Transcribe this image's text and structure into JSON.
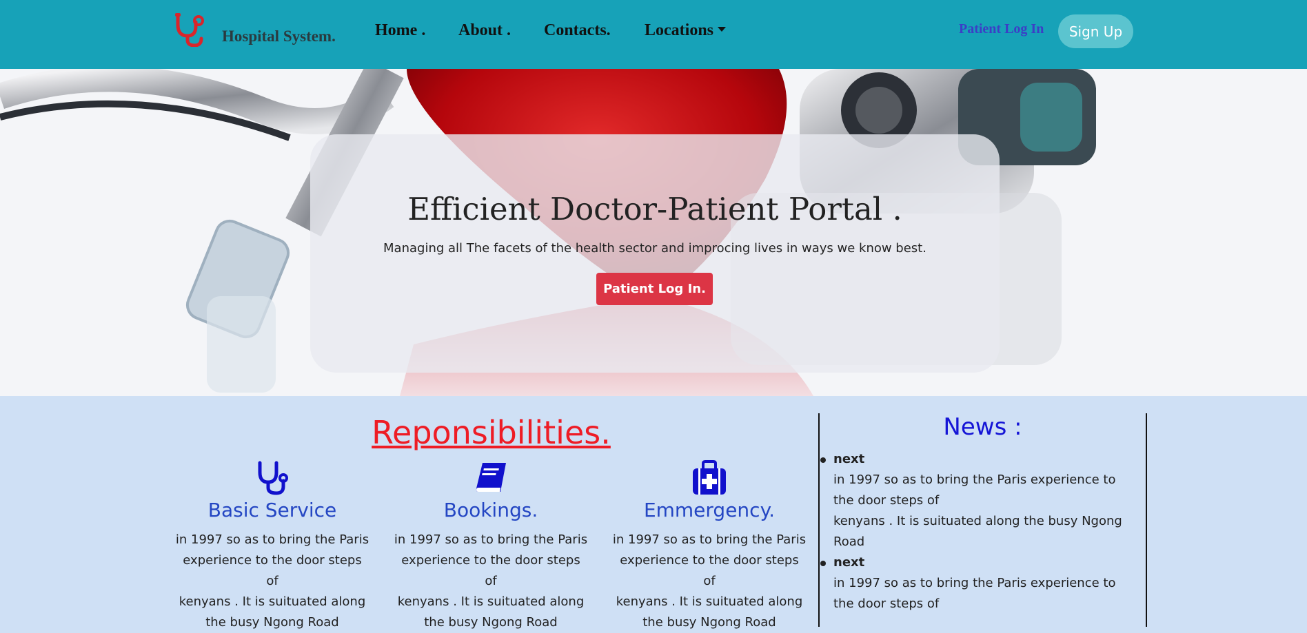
{
  "nav": {
    "brand": "Hospital System.",
    "links": [
      "Home .",
      "About .",
      "Contacts.",
      "Locations"
    ],
    "patient_login": "Patient Log In",
    "signup": "Sign Up"
  },
  "hero": {
    "title": "Efficient Doctor-Patient Portal .",
    "subtitle": "Managing all The facets of the health sector and improcing lives in ways we know best.",
    "button": "Patient Log In."
  },
  "responsibilities": {
    "title": "Reponsibilities.",
    "cards": [
      {
        "icon": "stethoscope-icon",
        "title": "Basic Service",
        "lines": [
          "in 1997  so as to bring the Paris",
          "experience to the door steps",
          "of",
          "kenyans . It is suituated along",
          "the busy Ngong Road"
        ]
      },
      {
        "icon": "book-icon",
        "title": "Bookings.",
        "lines": [
          "in 1997  so as to bring the Paris",
          "experience to the door steps",
          "of",
          "kenyans . It is suituated along",
          "the busy Ngong Road"
        ]
      },
      {
        "icon": "medical-kit-icon",
        "title": "Emmergency.",
        "lines": [
          "in 1997  so as to bring the Paris",
          "experience to the door steps",
          "of",
          "kenyans . It is suituated along",
          "the busy Ngong Road"
        ]
      }
    ]
  },
  "news": {
    "title": "News :",
    "items": [
      {
        "head": "next",
        "lines": [
          "in 1997  so as to bring the Paris experience to",
          "the door steps of",
          "kenyans . It is suituated along the busy Ngong",
          "Road"
        ]
      },
      {
        "head": "next",
        "lines": [
          "in 1997  so as to bring the Paris experience to",
          "the door steps of"
        ]
      }
    ]
  },
  "colors": {
    "navbar": "#17a2b8",
    "signup": "#5bc4cf",
    "danger": "#dc3545",
    "section_bg": "#cfe0f5",
    "heading_red": "#ee1c25",
    "card_blue": "#2446c3",
    "news_blue": "#1515d6"
  }
}
